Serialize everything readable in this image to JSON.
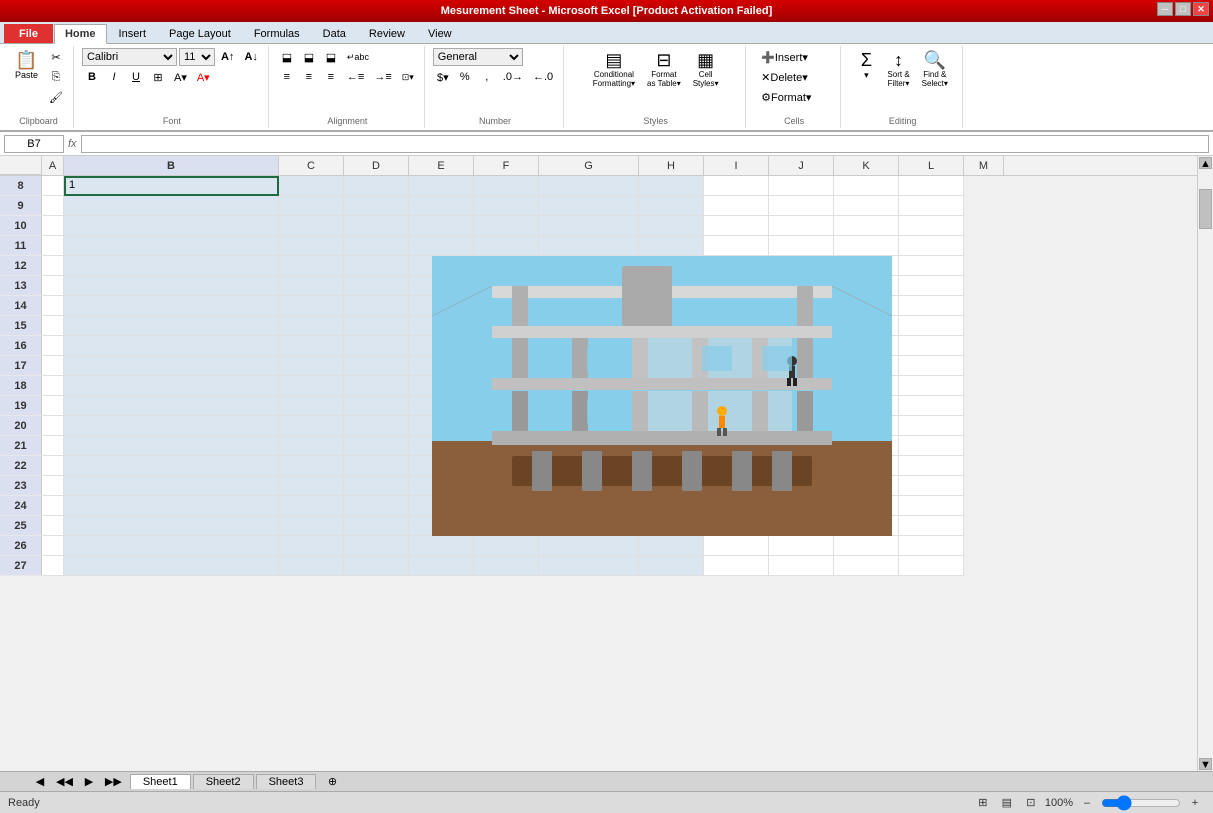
{
  "titleBar": {
    "title": "Mesurement Sheet - Microsoft Excel [Product Activation Failed]"
  },
  "tabs": [
    {
      "label": "File",
      "active": false
    },
    {
      "label": "Home",
      "active": true
    },
    {
      "label": "Insert",
      "active": false
    },
    {
      "label": "Page Layout",
      "active": false
    },
    {
      "label": "Formulas",
      "active": false
    },
    {
      "label": "Data",
      "active": false
    },
    {
      "label": "Review",
      "active": false
    },
    {
      "label": "View",
      "active": false
    }
  ],
  "ribbon": {
    "clipboard": {
      "label": "Clipboard",
      "paste": "Paste",
      "cut": "Cut",
      "copy": "Copy",
      "format_painter": "Format Painter"
    },
    "font": {
      "label": "Font",
      "name": "Calibri",
      "size": "11"
    },
    "alignment": {
      "label": "Alignment"
    },
    "number": {
      "label": "Number",
      "format": "General"
    },
    "styles": {
      "label": "Styles",
      "conditional_formatting": "Conditional Formatting",
      "format_as_table": "Format as Table",
      "cell_styles": "Cell Styles"
    },
    "cells": {
      "label": "Cells",
      "insert": "Insert",
      "delete": "Delete",
      "format": "Format"
    },
    "editing": {
      "label": "Editing",
      "sum": "Σ",
      "sort_filter": "Sort & Filter",
      "find_select": "Find & Select"
    }
  },
  "formulaBar": {
    "cellRef": "B7",
    "formula": ""
  },
  "columns": [
    "A",
    "B",
    "C",
    "D",
    "E",
    "F",
    "G",
    "H",
    "I",
    "J",
    "K",
    "L",
    "M"
  ],
  "rows": [
    8,
    9,
    10,
    11,
    12,
    13,
    14,
    15,
    16,
    17,
    18,
    19,
    20,
    21,
    22,
    23,
    24,
    25,
    26,
    27
  ],
  "rowData": {
    "8": {
      "A": "",
      "B": "1",
      "C": "",
      "D": "",
      "E": "",
      "F": "",
      "G": "",
      "H": "",
      "I": "",
      "J": ""
    },
    "9": {
      "A": "",
      "B": "",
      "C": "",
      "D": "",
      "E": "",
      "F": "",
      "G": "",
      "H": "",
      "I": "",
      "J": ""
    },
    "10": {
      "A": "",
      "B": "",
      "C": "",
      "D": "",
      "E": "",
      "F": "",
      "G": "",
      "H": "",
      "I": "",
      "J": ""
    },
    "11": {
      "A": "",
      "B": "",
      "C": "",
      "D": "",
      "E": "",
      "F": "",
      "G": "",
      "H": "",
      "I": "",
      "J": ""
    },
    "12": {
      "A": "",
      "B": "",
      "C": "",
      "D": "",
      "E": "",
      "F": "",
      "G": "",
      "H": "",
      "I": "",
      "J": ""
    },
    "13": {
      "A": "",
      "B": "",
      "C": "",
      "D": "",
      "E": "",
      "F": "",
      "G": "",
      "H": "",
      "I": "",
      "J": ""
    },
    "14": {
      "A": "",
      "B": "",
      "C": "",
      "D": "",
      "E": "",
      "F": "",
      "G": "",
      "H": "",
      "I": "",
      "J": ""
    },
    "15": {
      "A": "",
      "B": "",
      "C": "",
      "D": "",
      "E": "",
      "F": "",
      "G": "",
      "H": "",
      "I": "",
      "J": ""
    },
    "16": {
      "A": "",
      "B": "",
      "C": "",
      "D": "",
      "E": "",
      "F": "",
      "G": "",
      "H": "",
      "I": "",
      "J": ""
    },
    "17": {
      "A": "",
      "B": "",
      "C": "",
      "D": "",
      "E": "",
      "F": "",
      "G": "",
      "H": "",
      "I": "",
      "J": ""
    },
    "18": {
      "A": "",
      "B": "",
      "C": "",
      "D": "",
      "E": "",
      "F": "",
      "G": "",
      "H": "",
      "I": "",
      "J": ""
    },
    "19": {
      "A": "",
      "B": "",
      "C": "",
      "D": "",
      "E": "",
      "F": "",
      "G": "",
      "H": "",
      "I": "",
      "J": ""
    },
    "20": {
      "A": "",
      "B": "",
      "C": "",
      "D": "",
      "E": "",
      "F": "",
      "G": "",
      "H": "",
      "I": "",
      "J": ""
    },
    "21": {
      "A": "",
      "B": "",
      "C": "",
      "D": "",
      "E": "",
      "F": "",
      "G": "",
      "H": "",
      "I": "",
      "J": ""
    },
    "22": {
      "A": "",
      "B": "",
      "C": "",
      "D": "",
      "E": "",
      "F": "",
      "G": "",
      "H": "",
      "I": "",
      "J": ""
    },
    "23": {
      "A": "",
      "B": "",
      "C": "",
      "D": "",
      "E": "",
      "F": "",
      "G": "",
      "H": "",
      "I": "",
      "J": ""
    },
    "24": {
      "A": "",
      "B": "",
      "C": "",
      "D": "",
      "E": "",
      "F": "",
      "G": "",
      "H": "",
      "I": "",
      "J": ""
    },
    "25": {
      "A": "",
      "B": "",
      "C": "",
      "D": "",
      "E": "",
      "F": "",
      "G": "",
      "H": "",
      "I": "",
      "J": ""
    }
  },
  "sheetTabs": [
    "Sheet1",
    "Sheet2",
    "Sheet3"
  ],
  "activeSheet": "Sheet1",
  "statusBar": {
    "status": "Ready",
    "zoom": "100%"
  }
}
